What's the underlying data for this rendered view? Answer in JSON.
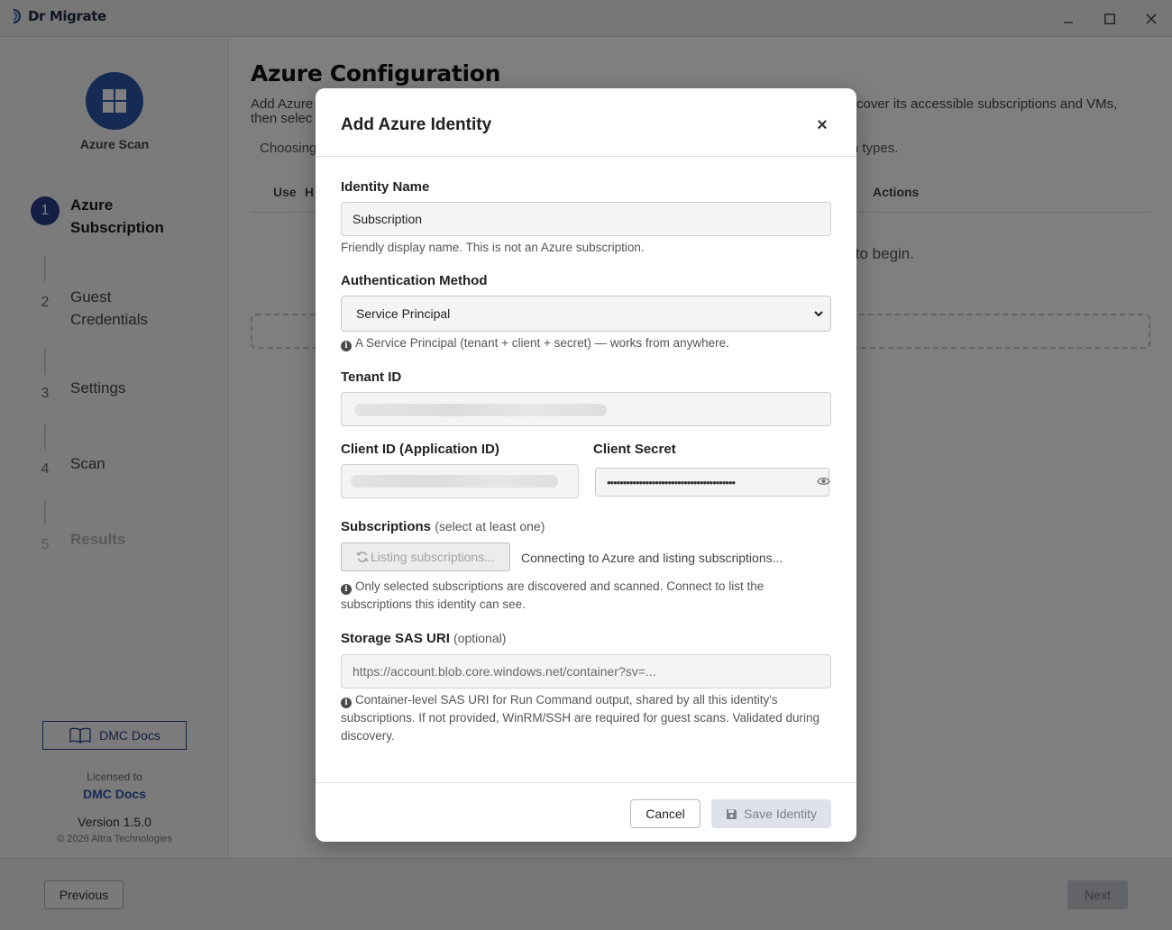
{
  "window": {
    "app_name": "Dr Migrate",
    "minimize": "–",
    "maximize": "☐",
    "close": "✕"
  },
  "sidebar": {
    "scan_title": "Azure Scan",
    "steps": [
      {
        "num": "1",
        "label": "Azure\nSubscription",
        "state": "active"
      },
      {
        "num": "2",
        "label": "Guest\nCredentials",
        "state": "normal"
      },
      {
        "num": "3",
        "label": "Settings",
        "state": "normal"
      },
      {
        "num": "4",
        "label": "Scan",
        "state": "normal"
      },
      {
        "num": "5",
        "label": "Results",
        "state": "disabled"
      }
    ],
    "docs_button": "DMC Docs",
    "licensed_to_label": "Licensed to",
    "licensee": "DMC Docs",
    "version": "Version 1.5.0",
    "copyright": "© 2026 Altra Technologies"
  },
  "main": {
    "title": "Azure Configuration",
    "description_left": "Add Azure",
    "description_left2": "then selec",
    "description_right": "cover its accessible subscriptions and VMs,",
    "choosing_left": "Choosing",
    "choosing_right": "can types.",
    "table_headers": {
      "use": "Use",
      "h": "H",
      "actions": "Actions"
    },
    "empty_message": "\" to begin."
  },
  "footer": {
    "previous": "Previous",
    "next": "Next"
  },
  "modal": {
    "title": "Add Azure Identity",
    "close": "×",
    "identity_name": {
      "label": "Identity Name",
      "value": "Subscription",
      "help": "Friendly display name. This is not an Azure subscription."
    },
    "auth_method": {
      "label": "Authentication Method",
      "selected": "Service Principal",
      "help": "A Service Principal (tenant + client + secret) — works from anywhere."
    },
    "tenant_id": {
      "label": "Tenant ID"
    },
    "client_id": {
      "label": "Client ID (Application ID)"
    },
    "client_secret": {
      "label": "Client Secret",
      "masked": "••••••••••••••••••••••••••••••••••••••••"
    },
    "subscriptions": {
      "label": "Subscriptions",
      "sub_label": "(select at least one)",
      "button": "Listing subscriptions...",
      "status": "Connecting to Azure and listing subscriptions...",
      "help": "Only selected subscriptions are discovered and scanned. Connect to list the subscriptions this identity can see."
    },
    "storage": {
      "label": "Storage SAS URI",
      "sub_label": "(optional)",
      "placeholder": "https://account.blob.core.windows.net/container?sv=...",
      "help": "Container-level SAS URI for Run Command output, shared by all this identity's subscriptions. If not provided, WinRM/SSH are required for guest scans. Validated during discovery."
    },
    "cancel": "Cancel",
    "save": "Save Identity"
  },
  "colors": {
    "accent": "#2b3f8c",
    "brand_blue": "#2d56a8",
    "overlay": "rgba(0,0,0,0.5)"
  },
  "icons": {
    "app_logo": "dr-migrate-logo-icon",
    "scan": "windows-icon",
    "docs": "book-icon",
    "info": "info-icon",
    "refresh": "refresh-icon",
    "eye": "eye-icon",
    "save": "floppy-disk-icon",
    "select": "chevron-down-icon"
  }
}
